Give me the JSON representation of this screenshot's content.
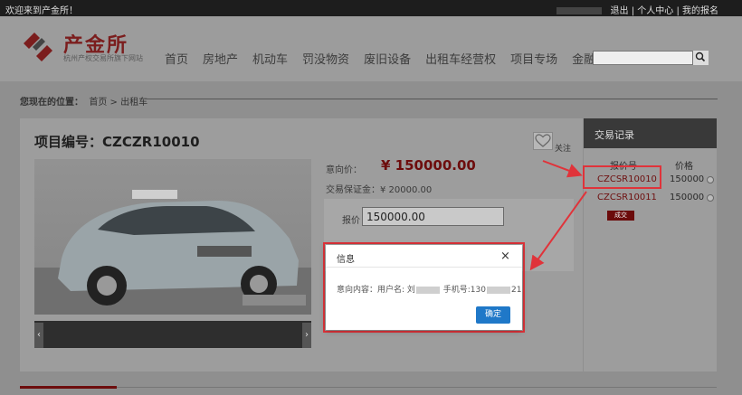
{
  "topbar": {
    "welcome": "欢迎来到产金所！",
    "logout": "退出",
    "personal_center": "个人中心",
    "my_signup": "我的报名",
    "sep": "|"
  },
  "logo": {
    "title": "产金所",
    "subtitle": "杭州产权交易所旗下网站"
  },
  "nav": [
    "首页",
    "房地产",
    "机动车",
    "罚没物资",
    "废旧设备",
    "出租车经营权",
    "项目专场",
    "金融服务"
  ],
  "breadcrumb": {
    "label": "您现在的位置：",
    "home": "首页",
    "sep": ">",
    "current": "出租车"
  },
  "project": {
    "title_label": "项目编号：",
    "code": "CZCZR10010",
    "follow": "关注",
    "intent_price_label": "意向价：",
    "intent_price": "¥ 150000.00",
    "deposit_label": "交易保证金：",
    "deposit": "¥ 20000.00",
    "offer_label": "报价",
    "offer_value": "150000.00"
  },
  "thumbs": {
    "prev": "‹",
    "next": "›"
  },
  "side": {
    "title": "交易记录",
    "col_code": "报价号",
    "col_price": "价格",
    "rows": [
      {
        "code": "CZCSR10010",
        "price": "150000"
      },
      {
        "code": "CZCSR10011",
        "price": "150000"
      }
    ],
    "deal_label": "成交"
  },
  "dialog": {
    "title": "信息",
    "close": "×",
    "msg_prefix": "意向内容：用户名: 刘",
    "msg_mid": " 手机号:130",
    "msg_end": "21",
    "ok": "确定"
  },
  "colors": {
    "brand": "#7b1d1d",
    "highlight": "#e0333a",
    "button": "#1f78c8"
  }
}
